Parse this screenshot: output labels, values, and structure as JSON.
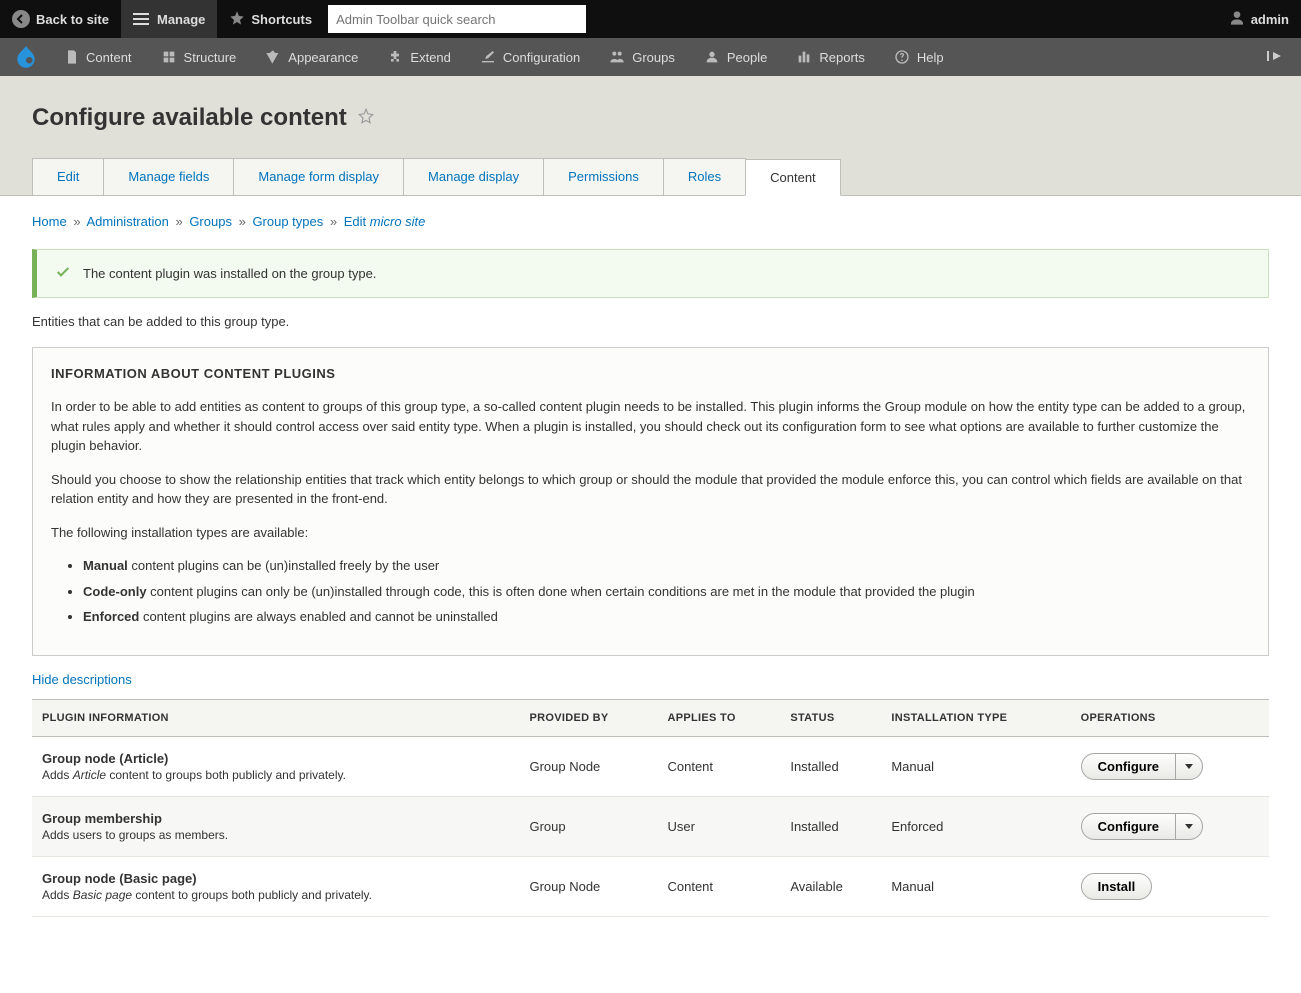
{
  "toolbarTop": {
    "back": "Back to site",
    "manage": "Manage",
    "shortcuts": "Shortcuts",
    "searchPlaceholder": "Admin Toolbar quick search",
    "user": "admin"
  },
  "toolbarAdmin": {
    "items": [
      {
        "label": "Content"
      },
      {
        "label": "Structure"
      },
      {
        "label": "Appearance"
      },
      {
        "label": "Extend"
      },
      {
        "label": "Configuration"
      },
      {
        "label": "Groups"
      },
      {
        "label": "People"
      },
      {
        "label": "Reports"
      },
      {
        "label": "Help"
      }
    ]
  },
  "pageTitle": "Configure available content",
  "tabs": [
    {
      "label": "Edit",
      "active": false
    },
    {
      "label": "Manage fields",
      "active": false
    },
    {
      "label": "Manage form display",
      "active": false
    },
    {
      "label": "Manage display",
      "active": false
    },
    {
      "label": "Permissions",
      "active": false
    },
    {
      "label": "Roles",
      "active": false
    },
    {
      "label": "Content",
      "active": true
    }
  ],
  "breadcrumbs": {
    "home": "Home",
    "admin": "Administration",
    "groups": "Groups",
    "types": "Group types",
    "editPrefix": "Edit",
    "editEm": "micro site"
  },
  "statusMessage": "The content plugin was installed on the group type.",
  "introText": "Entities that can be added to this group type.",
  "infoBox": {
    "title": "Information about content plugins",
    "p1": "In order to be able to add entities as content to groups of this group type, a so-called content plugin needs to be installed. This plugin informs the Group module on how the entity type can be added to a group, what rules apply and whether it should control access over said entity type. When a plugin is installed, you should check out its configuration form to see what options are available to further customize the plugin behavior.",
    "p2": "Should you choose to show the relationship entities that track which entity belongs to which group or should the module that provided the module enforce this, you can control which fields are available on that relation entity and how they are presented in the front-end.",
    "p3": "The following installation types are available:",
    "li1Strong": "Manual",
    "li1Rest": " content plugins can be (un)installed freely by the user",
    "li2Strong": "Code-only",
    "li2Rest": " content plugins can only be (un)installed through code, this is often done when certain conditions are met in the module that provided the plugin",
    "li3Strong": "Enforced",
    "li3Rest": " content plugins are always enabled and cannot be uninstalled"
  },
  "hideDescriptions": "Hide descriptions",
  "tableHeaders": {
    "plugin": "Plugin information",
    "provided": "Provided by",
    "applies": "Applies to",
    "status": "Status",
    "install": "Installation type",
    "ops": "Operations"
  },
  "rows": [
    {
      "name": "Group node (Article)",
      "descPrefix": "Adds ",
      "descEm": "Article",
      "descSuffix": " content to groups both publicly and privately.",
      "provided": "Group Node",
      "applies": "Content",
      "status": "Installed",
      "installType": "Manual",
      "opLabel": "Configure",
      "hasDrop": true
    },
    {
      "name": "Group membership",
      "descPrefix": "Adds users to groups as members.",
      "descEm": "",
      "descSuffix": "",
      "provided": "Group",
      "applies": "User",
      "status": "Installed",
      "installType": "Enforced",
      "opLabel": "Configure",
      "hasDrop": true
    },
    {
      "name": "Group node (Basic page)",
      "descPrefix": "Adds ",
      "descEm": "Basic page",
      "descSuffix": " content to groups both publicly and privately.",
      "provided": "Group Node",
      "applies": "Content",
      "status": "Available",
      "installType": "Manual",
      "opLabel": "Install",
      "hasDrop": false
    }
  ]
}
